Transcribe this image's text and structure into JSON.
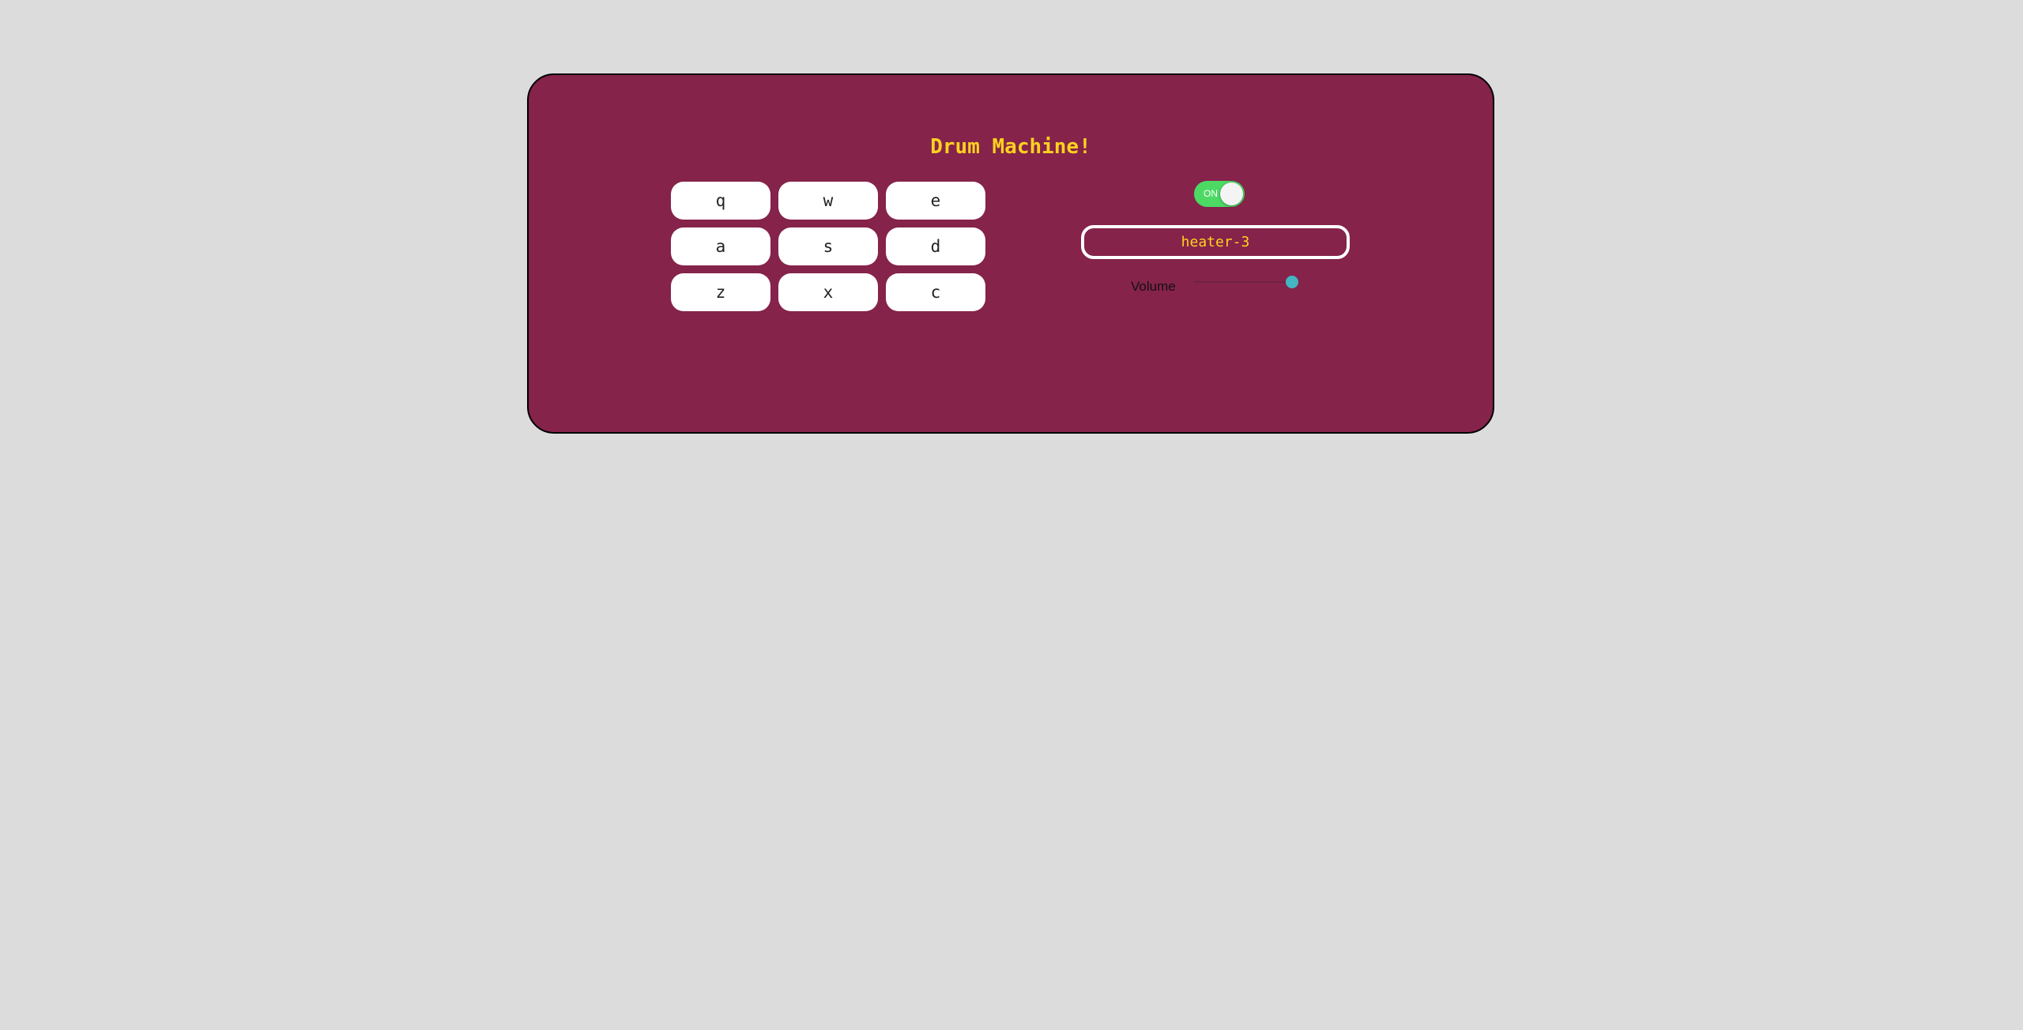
{
  "app": {
    "title": "Drum Machine!"
  },
  "pads": [
    {
      "key": "q"
    },
    {
      "key": "w"
    },
    {
      "key": "e"
    },
    {
      "key": "a"
    },
    {
      "key": "s"
    },
    {
      "key": "d"
    },
    {
      "key": "z"
    },
    {
      "key": "x"
    },
    {
      "key": "c"
    }
  ],
  "controls": {
    "power": {
      "label": "ON",
      "state": "on",
      "color": "#4cd964"
    },
    "display": {
      "value": "heater-3"
    },
    "volume": {
      "label": "Volume",
      "value": 1.0,
      "thumb_color": "#43b6c2"
    }
  },
  "colors": {
    "background": "#dddcdc",
    "machine": "#85234a",
    "accent": "#ffd21f",
    "pad": "#ffffff"
  }
}
